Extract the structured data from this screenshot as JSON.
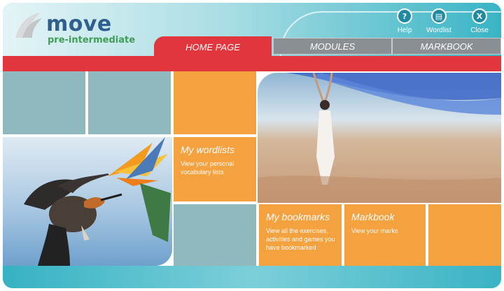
{
  "logo": {
    "word": "move",
    "subtitle": "pre-intermediate"
  },
  "utilities": [
    {
      "label": "Help",
      "glyph": "?",
      "icon": "help-icon"
    },
    {
      "label": "Wordlist",
      "glyph": "▤",
      "icon": "wordlist-icon"
    },
    {
      "label": "Close",
      "glyph": "X",
      "icon": "close-icon"
    }
  ],
  "tabs": [
    {
      "label": "HOME PAGE",
      "active": true
    },
    {
      "label": "MODULES",
      "active": false
    },
    {
      "label": "MARKBOOK",
      "active": false
    }
  ],
  "cards": {
    "wordlists": {
      "title": "My wordlists",
      "desc": "View your personal vocabulary lists"
    },
    "bookmarks": {
      "title": "My bookmarks",
      "desc": "View all the exercises, activities and games you have bookmarked"
    },
    "markbook": {
      "title": "Markbook",
      "desc": "View your marks"
    }
  },
  "colors": {
    "accent_red": "#e2363f",
    "tile_orange": "#f4a23f",
    "tile_teal": "#8fb9bf",
    "brand_blue": "#2f5f8e",
    "brand_green": "#3f9d55"
  }
}
